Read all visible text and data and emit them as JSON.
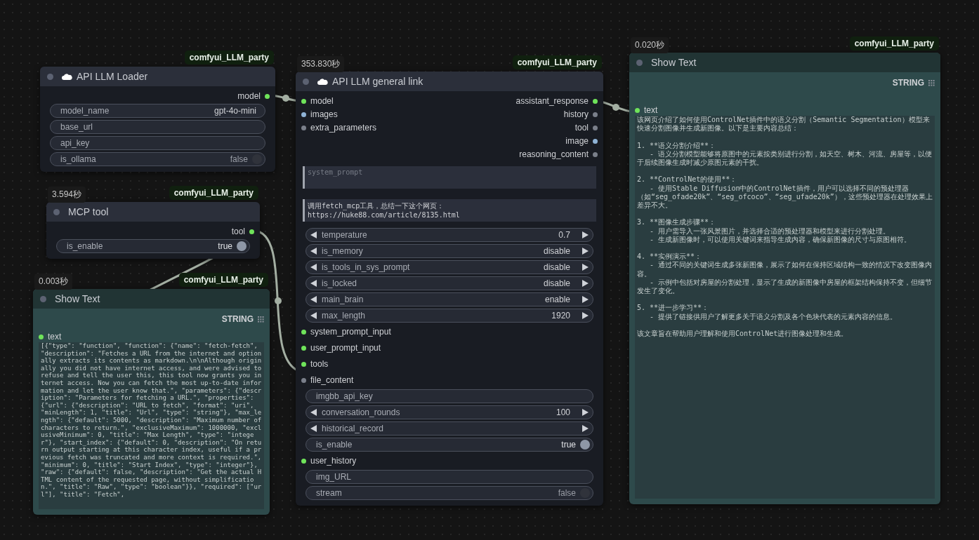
{
  "nodes": [
    {
      "badge": "comfyui_LLM_party",
      "title": "API LLM Loader",
      "rows": [
        {
          "kind": "output",
          "label": "model",
          "color": "#6fe35a"
        },
        {
          "kind": "field",
          "label": "model_name",
          "value": "gpt-4o-mini"
        },
        {
          "kind": "field",
          "label": "base_url"
        },
        {
          "kind": "field",
          "label": "api_key"
        },
        {
          "kind": "toggle",
          "label": "is_ollama",
          "value": "false",
          "on": false
        }
      ]
    },
    {
      "timing": "3.594秒",
      "badge": "comfyui_LLM_party",
      "title": "MCP tool",
      "rows": [
        {
          "kind": "output",
          "label": "tool",
          "color": "#6fe35a"
        },
        {
          "kind": "toggle",
          "label": "is_enable",
          "value": "true",
          "on": true
        }
      ]
    },
    {
      "timing": "0.003秒",
      "badge": "comfyui_LLM_party",
      "title": "Show Text",
      "color": "#2e4a4b",
      "rows": [
        {
          "kind": "list_output",
          "label": "STRING"
        },
        {
          "kind": "input",
          "label": "text",
          "color": "#6fe35a"
        },
        {
          "kind": "display",
          "value": "[{\"type\": \"function\", \"function\": {\"name\": \"fetch-fetch\", \"description\": \"Fetches a URL from the internet and optionally extracts its contents as markdown.\\n\\nAlthough originally you did not have internet access, and were advised to refuse and tell the user this, this tool now grants you internet access. Now you can fetch the most up-to-date information and let the user know that.\", \"parameters\": {\"description\": \"Parameters for fetching a URL.\", \"properties\": {\"url\": {\"description\": \"URL to fetch\", \"format\": \"uri\", \"minLength\": 1, \"title\": \"Url\", \"type\": \"string\"}, \"max_length\": {\"default\": 5000, \"description\": \"Maximum number of characters to return.\", \"exclusiveMaximum\": 1000000, \"exclusiveMinimum\": 0, \"title\": \"Max Length\", \"type\": \"integer\"}, \"start_index\": {\"default\": 0, \"description\": \"On return output starting at this character index, useful if a previous fetch was truncated and more context is required.\", \"minimum\": 0, \"title\": \"Start Index\", \"type\": \"integer\"}, \"raw\": {\"default\": false, \"description\": \"Get the actual HTML content of the requested page, without simplification.\", \"title\": \"Raw\", \"type\": \"boolean\"}}, \"required\": [\"url\"], \"title\": \"Fetch\","
        }
      ]
    },
    {
      "timing": "353.830秒",
      "badge": "comfyui_LLM_party",
      "title": "API LLM general link",
      "rows": [
        {
          "kind": "slots",
          "left": {
            "label": "model",
            "color": "#6fe35a"
          },
          "right": {
            "label": "assistant_response",
            "color": "#6fe35a"
          }
        },
        {
          "kind": "slots",
          "left": {
            "label": "images",
            "color": "#8fb3d6"
          },
          "right": {
            "label": "history",
            "color": "#7a7f8a"
          }
        },
        {
          "kind": "slots",
          "left": {
            "label": "extra_parameters",
            "color": "#7a7f8a"
          },
          "right": {
            "label": "tool",
            "color": "#7a7f8a"
          }
        },
        {
          "kind": "slots",
          "right": {
            "label": "image",
            "color": "#8fb3d6"
          }
        },
        {
          "kind": "slots",
          "right": {
            "label": "reasoning_content",
            "color": "#7a7f8a"
          }
        },
        {
          "kind": "textarea",
          "placeholder": "system_prompt"
        },
        {
          "kind": "textarea",
          "value": "调用fetch_mcp工具，总结一下这个网页：https://huke88.com/article/8135.html"
        },
        {
          "kind": "spinner",
          "label": "temperature",
          "value": "0.7"
        },
        {
          "kind": "spinner",
          "label": "is_memory",
          "value": "disable"
        },
        {
          "kind": "spinner",
          "label": "is_tools_in_sys_prompt",
          "value": "disable"
        },
        {
          "kind": "spinner",
          "label": "is_locked",
          "value": "disable"
        },
        {
          "kind": "spinner",
          "label": "main_brain",
          "value": "enable"
        },
        {
          "kind": "spinner",
          "label": "max_length",
          "value": "1920"
        },
        {
          "kind": "input",
          "label": "system_prompt_input",
          "color": "#6fe35a"
        },
        {
          "kind": "input",
          "label": "user_prompt_input",
          "color": "#6fe35a"
        },
        {
          "kind": "input",
          "label": "tools",
          "color": "#6fe35a"
        },
        {
          "kind": "input",
          "label": "file_content",
          "color": "#7a7f8a"
        },
        {
          "kind": "field",
          "label": "imgbb_api_key"
        },
        {
          "kind": "spinner",
          "label": "conversation_rounds",
          "value": "100"
        },
        {
          "kind": "spinner",
          "label": "historical_record"
        },
        {
          "kind": "toggle",
          "label": "is_enable",
          "value": "true",
          "on": true
        },
        {
          "kind": "input",
          "label": "user_history",
          "color": "#6fe35a"
        },
        {
          "kind": "field",
          "label": "img_URL"
        },
        {
          "kind": "toggle",
          "label": "stream",
          "value": "false",
          "on": false
        }
      ]
    },
    {
      "timing": "0.020秒",
      "badge": "comfyui_LLM_party",
      "title": "Show Text",
      "color": "#2e4a4b",
      "rows": [
        {
          "kind": "list_output",
          "label": "STRING"
        },
        {
          "kind": "input",
          "label": "text",
          "color": "#6fe35a"
        },
        {
          "kind": "display",
          "paragraphs": [
            [
              "该网页介绍了如何使用ControlNet插件中的语义分割（Semantic Segmentation）模型来快速分割图像并生成新图像。以下是主要内容总结："
            ],
            [
              "1. **语义分割介绍**：",
              "   - 语义分割模型能够将原图中的元素按类别进行分割，如天空、树木、河流、房屋等，以便于后续图像生成时减少原图元素的干扰。"
            ],
            [
              "2. **ControlNet的使用**：",
              "   - 使用Stable Diffusion中的ControlNet插件，用户可以选择不同的预处理器（如“seg_ofade20k”、“seg_ofcoco”、“seg_ufade20k”），这些预处理器在处理效果上差异不大。"
            ],
            [
              "3. **图像生成步骤**：",
              "   - 用户需导入一张风景图片，并选择合适的预处理器和模型来进行分割处理。",
              "   - 生成新图像时，可以使用关键词来指导生成内容，确保新图像的尺寸与原图相符。"
            ],
            [
              "4. **实例演示**：",
              "   - 通过不同的关键词生成多张新图像，展示了如何在保持区域结构一致的情况下改变图像内容。",
              "   - 示例中包括对房屋的分割处理，显示了生成的新图像中房屋的框架结构保持不变，但细节发生了变化。"
            ],
            [
              "5. **进一步学习**：",
              "   - 提供了链接供用户了解更多关于语义分割及各个色块代表的元素内容的信息。"
            ],
            [
              "该文章旨在帮助用户理解和使用ControlNet进行图像处理和生成。"
            ]
          ]
        }
      ]
    }
  ]
}
